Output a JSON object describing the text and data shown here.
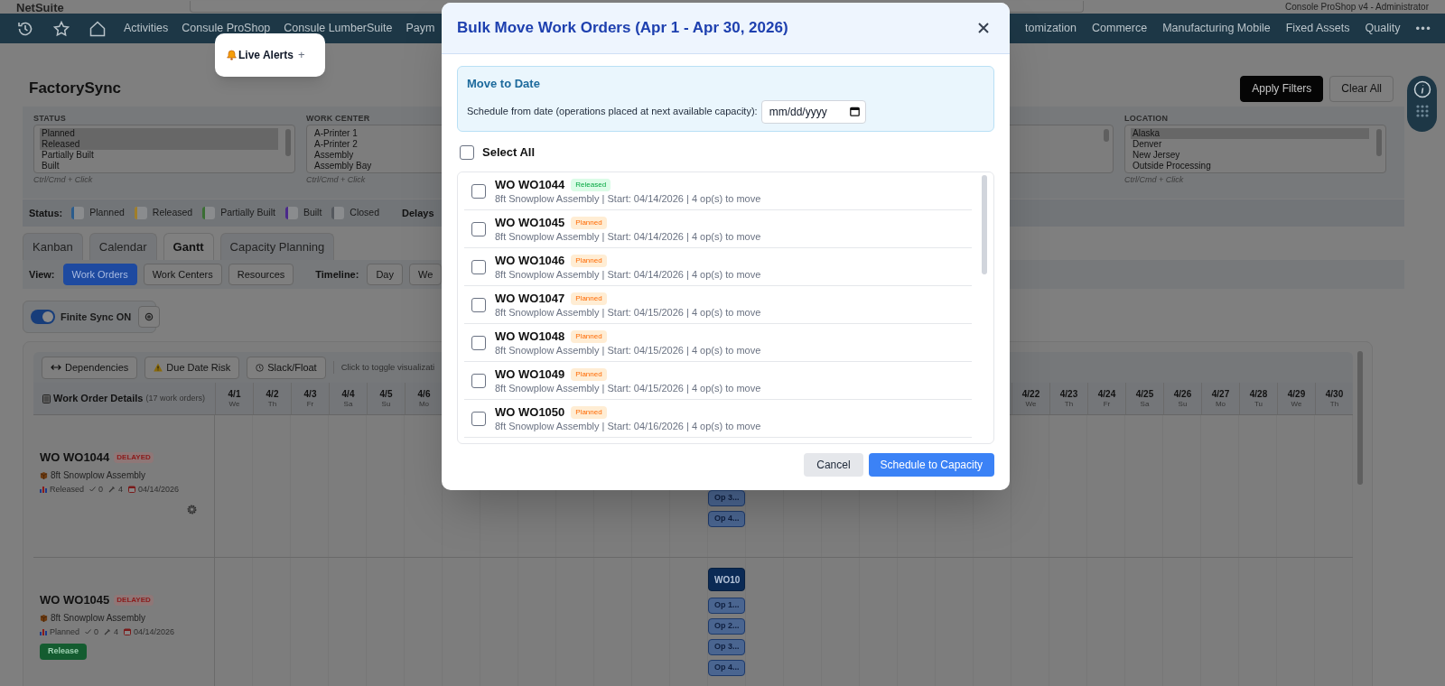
{
  "app_header": {
    "logo": "NetSuite",
    "account": "Console ProShop v4 - Administrator"
  },
  "nav": {
    "left_items": [
      "Activities",
      "Consule ProShop",
      "Consule LumberSuite",
      "Paym"
    ],
    "right_items": [
      "tomization",
      "Commerce",
      "Manufacturing Mobile",
      "Fixed Assets",
      "Quality"
    ],
    "more": "•••"
  },
  "live_alerts": {
    "label": "Live Alerts",
    "add": "+"
  },
  "page": {
    "title": "FactorySync",
    "buttons": [
      {
        "label": "Apply Filters",
        "kind": "primary"
      },
      {
        "label": "Clear All",
        "kind": "secondary"
      }
    ]
  },
  "filters": [
    {
      "label": "STATUS",
      "hint": "Ctrl/Cmd + Click",
      "options": [
        {
          "label": "Planned",
          "selected": true
        },
        {
          "label": "Released",
          "selected": true
        },
        {
          "label": "Partially Built",
          "selected": false
        },
        {
          "label": "Built",
          "selected": false
        }
      ]
    },
    {
      "label": "WORK CENTER",
      "hint": "Ctrl/Cmd + Click",
      "options": [
        {
          "label": "A-Printer 1",
          "selected": false
        },
        {
          "label": "A-Printer 2",
          "selected": false
        },
        {
          "label": "Assembly",
          "selected": false
        },
        {
          "label": "Assembly Bay",
          "selected": false
        }
      ]
    },
    {
      "label": "LOCATION",
      "hint": "Ctrl/Cmd + Click",
      "options": [
        {
          "label": "Alaska",
          "selected": true
        },
        {
          "label": "Denver",
          "selected": false
        },
        {
          "label": "New Jersey",
          "selected": false
        },
        {
          "label": "Outside Processing",
          "selected": false
        }
      ]
    }
  ],
  "status_legend": {
    "label": "Status:",
    "delays_label": "Delays",
    "items": [
      {
        "label": "Planned",
        "color": "#2b5c8c"
      },
      {
        "label": "Released",
        "color": "#a07e2a"
      },
      {
        "label": "Partially Built",
        "color": "#3a6e34"
      },
      {
        "label": "Built",
        "color": "#4b2a8a"
      },
      {
        "label": "Closed",
        "color": "#55595e"
      }
    ]
  },
  "tabs": [
    {
      "label": "Kanban",
      "selected": false
    },
    {
      "label": "Calendar",
      "selected": false
    },
    {
      "label": "Gantt",
      "selected": true
    },
    {
      "label": "Capacity Planning",
      "selected": false
    }
  ],
  "view": {
    "label": "View:",
    "options": [
      {
        "label": "Work Orders",
        "selected": true
      },
      {
        "label": "Work Centers",
        "selected": false
      },
      {
        "label": "Resources",
        "selected": false
      }
    ]
  },
  "timeline": {
    "label": "Timeline:",
    "options": [
      {
        "label": "Day",
        "selected": false
      },
      {
        "label": "We",
        "selected": false
      }
    ]
  },
  "finite_sync": {
    "label": "Finite Sync ON",
    "on": true
  },
  "gantt": {
    "toolbar": [
      {
        "label": "Dependencies",
        "kind": "arrows"
      },
      {
        "label": "Due Date Risk",
        "kind": "warning"
      },
      {
        "label": "Slack/Float",
        "kind": "clock"
      }
    ],
    "hint": "Click to toggle visualizati",
    "details_header": "Work Order Details",
    "count": "(17 work orders)",
    "dates_start": [
      {
        "date": "4/1",
        "day": "We"
      },
      {
        "date": "4/2",
        "day": "Th"
      },
      {
        "date": "4/3",
        "day": "Fr"
      },
      {
        "date": "4/4",
        "day": "Sa"
      },
      {
        "date": "4/5",
        "day": "Su"
      },
      {
        "date": "4/6",
        "day": "Mo"
      }
    ],
    "dates_end": [
      {
        "date": "4/22",
        "day": "We"
      },
      {
        "date": "4/23",
        "day": "Th"
      },
      {
        "date": "4/24",
        "day": "Fr"
      },
      {
        "date": "4/25",
        "day": "Sa"
      },
      {
        "date": "4/26",
        "day": "Su"
      },
      {
        "date": "4/27",
        "day": "Mo"
      },
      {
        "date": "4/28",
        "day": "Tu"
      },
      {
        "date": "4/29",
        "day": "We"
      },
      {
        "date": "4/30",
        "day": "Th"
      }
    ],
    "rows": [
      {
        "title": "WO WO1044",
        "flag": "DELAYED",
        "item": "8ft Snowplow Assembly",
        "status": "Released",
        "done": "0",
        "ops": "4",
        "date": "04/14/2026",
        "settings": true,
        "bars": [
          {
            "label": "Op 3...",
            "kind": "op"
          },
          {
            "label": "Op 4...",
            "kind": "op"
          }
        ]
      },
      {
        "title": "WO WO1045",
        "flag": "DELAYED",
        "item": "8ft Snowplow Assembly",
        "status": "Planned",
        "done": "0",
        "ops": "4",
        "date": "04/14/2026",
        "settings": false,
        "action": "Release",
        "bars": [
          {
            "label": "WO10",
            "kind": "order"
          },
          {
            "label": "Op 1...",
            "kind": "op"
          },
          {
            "label": "Op 2...",
            "kind": "op"
          },
          {
            "label": "Op 3...",
            "kind": "op"
          },
          {
            "label": "Op 4...",
            "kind": "op"
          }
        ]
      }
    ]
  },
  "modal": {
    "title": "Bulk Move Work Orders (Apr 1 - Apr 30, 2026)",
    "move_to_date": {
      "title": "Move to Date",
      "label": "Schedule from date (operations placed at next available capacity):",
      "placeholder": "mm/dd/yyyy"
    },
    "select_all": {
      "label": "Select All",
      "checked": false
    },
    "orders": [
      {
        "title": "WO WO1044",
        "status": "Released",
        "kind": "released",
        "detail": "8ft Snowplow Assembly | Start: 04/14/2026 | 4 op(s) to move",
        "checked": false
      },
      {
        "title": "WO WO1045",
        "status": "Planned",
        "kind": "planned",
        "detail": "8ft Snowplow Assembly | Start: 04/14/2026 | 4 op(s) to move",
        "checked": false
      },
      {
        "title": "WO WO1046",
        "status": "Planned",
        "kind": "planned",
        "detail": "8ft Snowplow Assembly | Start: 04/14/2026 | 4 op(s) to move",
        "checked": false
      },
      {
        "title": "WO WO1047",
        "status": "Planned",
        "kind": "planned",
        "detail": "8ft Snowplow Assembly | Start: 04/15/2026 | 4 op(s) to move",
        "checked": false
      },
      {
        "title": "WO WO1048",
        "status": "Planned",
        "kind": "planned",
        "detail": "8ft Snowplow Assembly | Start: 04/15/2026 | 4 op(s) to move",
        "checked": false
      },
      {
        "title": "WO WO1049",
        "status": "Planned",
        "kind": "planned",
        "detail": "8ft Snowplow Assembly | Start: 04/15/2026 | 4 op(s) to move",
        "checked": false
      },
      {
        "title": "WO WO1050",
        "status": "Planned",
        "kind": "planned",
        "detail": "8ft Snowplow Assembly | Start: 04/16/2026 | 4 op(s) to move",
        "checked": false
      }
    ],
    "buttons": [
      {
        "label": "Cancel",
        "kind": "secondary"
      },
      {
        "label": "Schedule to Capacity",
        "kind": "primary"
      }
    ]
  }
}
